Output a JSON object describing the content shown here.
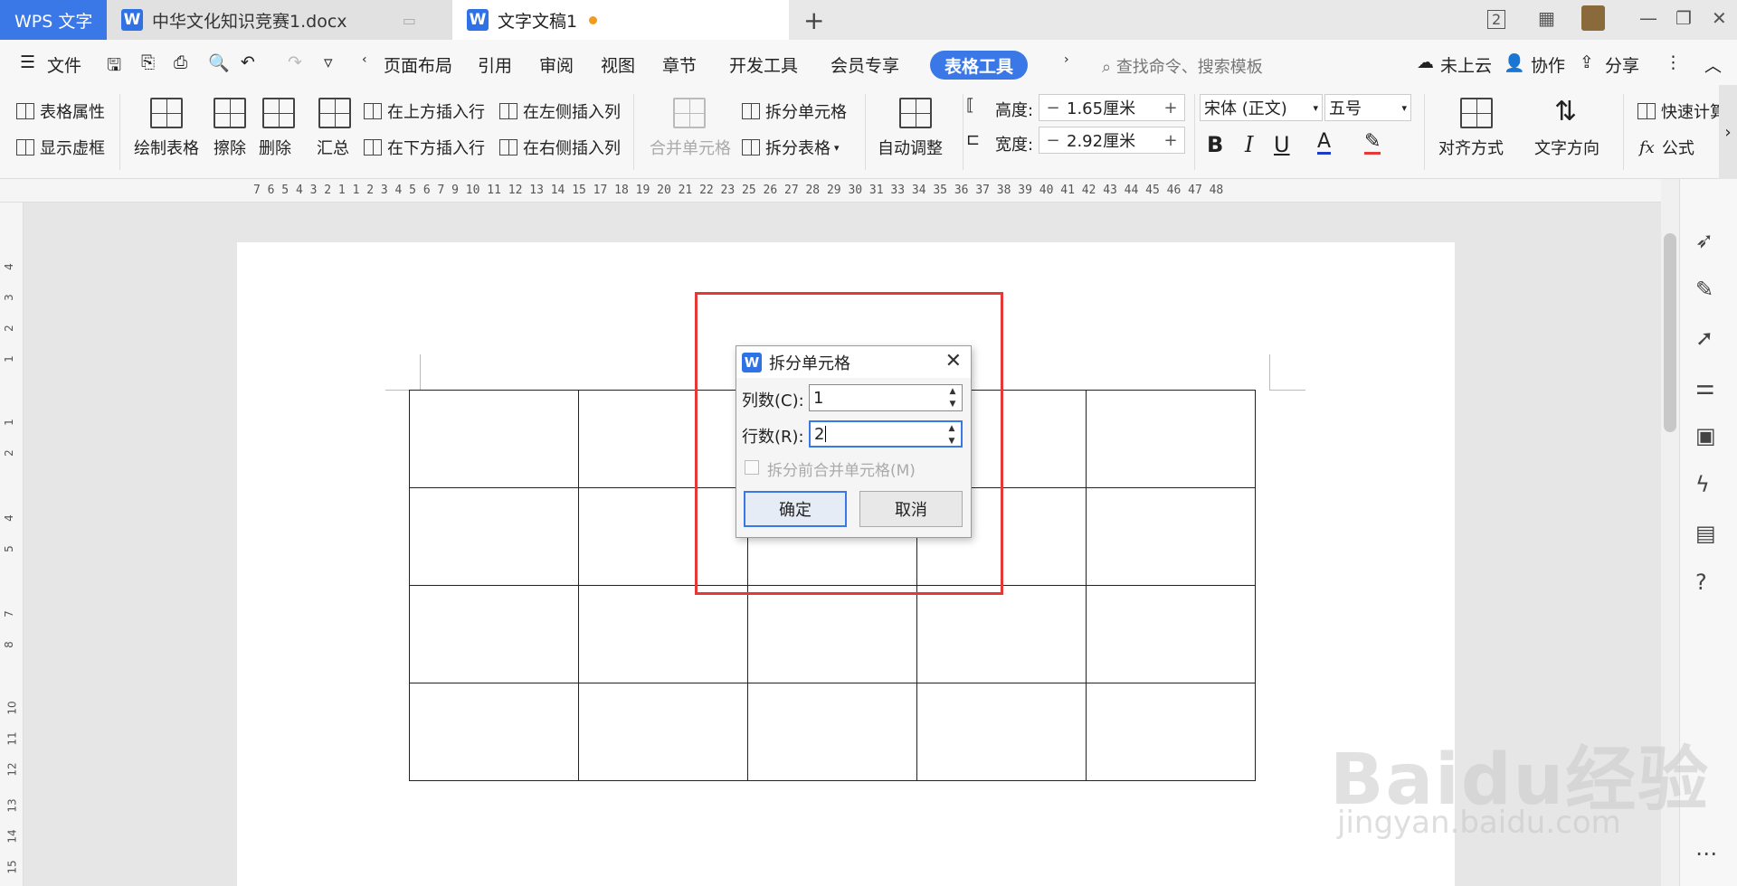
{
  "titlebar": {
    "app_tab": "WPS 文字",
    "doc_tab_1": "中华文化知识竞赛1.docx",
    "doc_tab_2": "文字文稿1",
    "new_tab": "+",
    "window_count": "2"
  },
  "menubar": {
    "file": "文件",
    "items": [
      "页面布局",
      "引用",
      "审阅",
      "视图",
      "章节",
      "开发工具",
      "会员专享"
    ],
    "active_tool": "表格工具",
    "search_placeholder": "查找命令、搜索模板",
    "cloud": "未上云",
    "collab": "协作",
    "share": "分享"
  },
  "ribbon": {
    "table_props": "表格属性",
    "show_grid": "显示虚框",
    "draw_table": "绘制表格",
    "erase": "擦除",
    "delete": "删除",
    "summary": "汇总",
    "insert_above": "在上方插入行",
    "insert_below": "在下方插入行",
    "insert_left": "在左侧插入列",
    "insert_right": "在右侧插入列",
    "merge_cells": "合并单元格",
    "split_cells": "拆分单元格",
    "split_table": "拆分表格",
    "auto_fit": "自动调整",
    "height_label": "高度:",
    "height_value": "1.65厘米",
    "width_label": "宽度:",
    "width_value": "2.92厘米",
    "font_name": "宋体 (正文)",
    "font_size": "五号",
    "align": "对齐方式",
    "text_dir": "文字方向",
    "quick_calc": "快速计算",
    "formula": "公式"
  },
  "ruler": {
    "horizontal": "7  6  5  4  3  2  1     1  2  3  4  5  6  7     9  10 11 12 13 14 15    17 18 19 20 21 22 23    25 26 27 28 29 30 31    33 34 35 36 37 38 39 40 41 42 43 44 45 46 47 48",
    "vertical": [
      "4",
      "3",
      "2",
      "1",
      "1",
      "2",
      "4",
      "5",
      "7",
      "8",
      "10",
      "11",
      "12",
      "13",
      "14",
      "15"
    ]
  },
  "dialog": {
    "title": "拆分单元格",
    "cols_label": "列数(C):",
    "cols_value": "1",
    "rows_label": "行数(R):",
    "rows_value": "2",
    "merge_before_label": "拆分前合并单元格(M)",
    "ok": "确定",
    "cancel": "取消"
  },
  "table": {
    "rows": 4,
    "cols": 5
  },
  "watermark": {
    "main": "Baidu经验",
    "sub": "jingyan.baidu.com"
  },
  "colors": {
    "accent": "#3b78e7",
    "highlight": "#e53935"
  }
}
